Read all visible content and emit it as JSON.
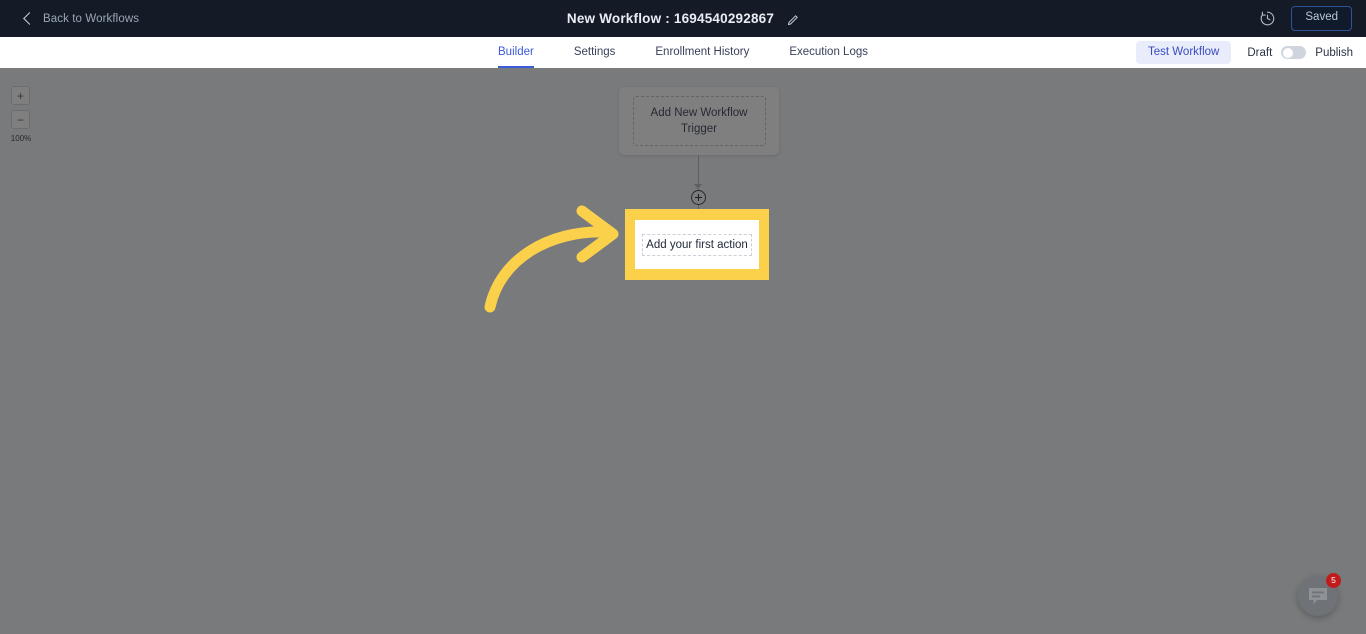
{
  "header": {
    "back_label": "Back to Workflows",
    "back_icon": "chevron-left-icon",
    "title": "New Workflow : 1694540292867",
    "edit_icon": "pencil-icon",
    "history_icon": "clock-history-icon",
    "save_status_label": "Saved"
  },
  "tabbar": {
    "tabs": [
      {
        "label": "Builder",
        "active": true
      },
      {
        "label": "Settings",
        "active": false
      },
      {
        "label": "Enrollment History",
        "active": false
      },
      {
        "label": "Execution Logs",
        "active": false
      }
    ],
    "test_workflow_label": "Test Workflow",
    "draft_label": "Draft",
    "publish_label": "Publish",
    "toggle_state": "off"
  },
  "canvas": {
    "zoom": {
      "zoom_in_label": "+",
      "zoom_out_label": "−",
      "level_label": "100%"
    },
    "trigger_node": {
      "label": "Add New Workflow Trigger"
    },
    "add_node_icon": "plus-circle-icon",
    "action_node": {
      "label": "Add your first action"
    },
    "annotation_arrow_icon": "curved-arrow-icon"
  },
  "chat_widget": {
    "icon": "chat-bubble-icon",
    "unread_count": "5"
  },
  "colors": {
    "header_bg": "#141b27",
    "accent_blue": "#3b5bdb",
    "highlight_yellow": "#fbd14b",
    "badge_red": "#c01c1c",
    "canvas_bg": "#f3f4f6"
  }
}
